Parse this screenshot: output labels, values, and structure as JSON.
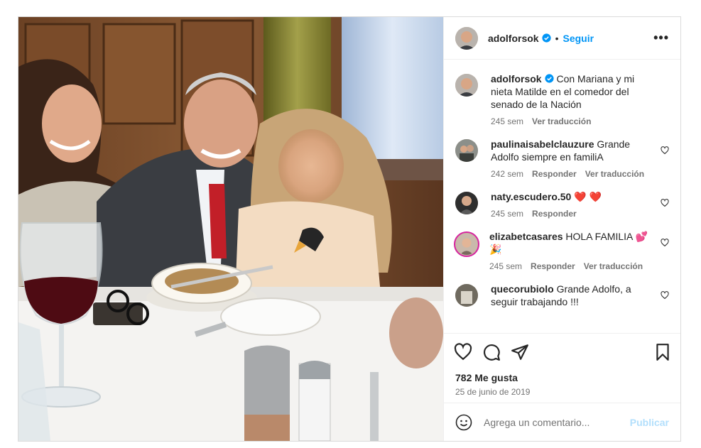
{
  "post": {
    "author": {
      "username": "adolforsok",
      "verified": true,
      "avatar_icon": "user-avatar-photo"
    },
    "follow_label": "Seguir",
    "separator": "•",
    "more_icon": "more-options-icon",
    "more_label": "•••",
    "caption": {
      "username": "adolforsok",
      "text": "Con Mariana y mi nieta Matilde en el comedor del senado de la Nación",
      "time": "245 sem",
      "translate": "Ver traducción"
    },
    "comments": [
      {
        "username": "paulinaisabelclauzure",
        "text": "Grande Adolfo siempre en familiA",
        "time": "242 sem",
        "reply": "Responder",
        "translate": "Ver traducción"
      },
      {
        "username": "naty.escudero.50",
        "text": "❤️ ❤️",
        "time": "245 sem",
        "reply": "Responder",
        "translate": ""
      },
      {
        "username": "elizabetcasares",
        "text": "HOLA FAMILIA 💕 🎉",
        "time": "245 sem",
        "reply": "Responder",
        "translate": "Ver traducción"
      },
      {
        "username": "quecorubiolo",
        "text": "Grande Adolfo, a seguir trabajando !!!",
        "time": "",
        "reply": "",
        "translate": ""
      }
    ],
    "likes": "782 Me gusta",
    "date": "25 de junio de 2019",
    "add_comment": {
      "placeholder": "Agrega un comentario...",
      "publish": "Publicar"
    },
    "icons": {
      "like": "heart-icon",
      "comment": "comment-bubble-icon",
      "share": "paper-plane-icon",
      "save": "bookmark-icon",
      "emoji": "emoji-smiley-icon"
    },
    "colors": {
      "accent": "#0095f6",
      "verified": "#0095f6",
      "publish_disabled": "#b2dffc",
      "muted": "#737373",
      "heart": "#ed4956"
    }
  }
}
